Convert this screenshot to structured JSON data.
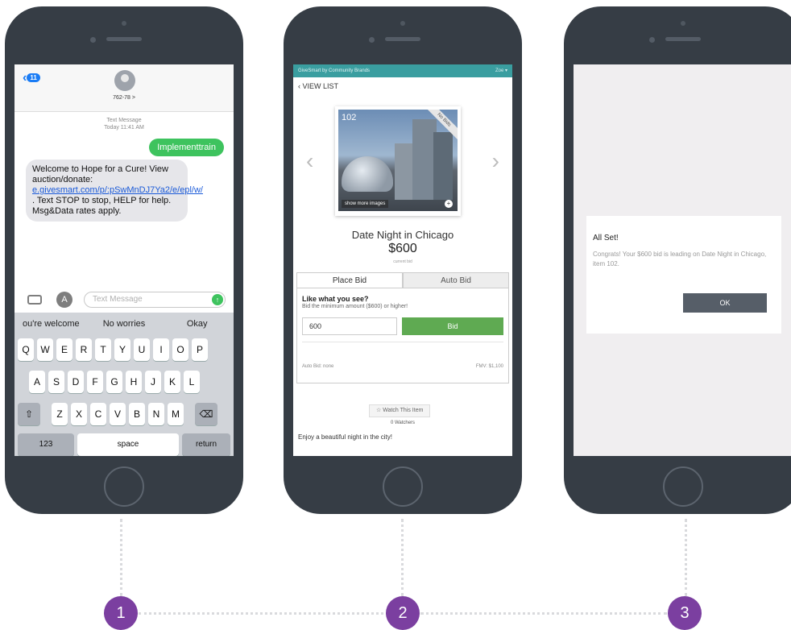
{
  "phone1": {
    "back_badge": "11",
    "contact": "762-78 >",
    "meta_type": "Text Message",
    "meta_time": "Today 11:41 AM",
    "outgoing": "Implementtrain",
    "incoming_pre": "Welcome to Hope for a Cure! View auction/donate: ",
    "incoming_link": "e.givesmart.com/p/:pSwMnDJ7Ya2/e/epl/w/",
    "incoming_post": " . Text STOP to stop, HELP for help. Msg&Data rates apply.",
    "input_placeholder": "Text Message",
    "suggestions": [
      "ou're welcome",
      "No worries",
      "Okay"
    ],
    "keys_row1": [
      "Q",
      "W",
      "E",
      "R",
      "T",
      "Y",
      "U",
      "I",
      "O",
      "P"
    ],
    "keys_row2": [
      "A",
      "S",
      "D",
      "F",
      "G",
      "H",
      "J",
      "K",
      "L"
    ],
    "keys_row3": [
      "Z",
      "X",
      "C",
      "V",
      "B",
      "N",
      "M"
    ],
    "key_123": "123",
    "key_space": "space",
    "key_return": "return"
  },
  "phone2": {
    "brand": "GiveSmart by Community Brands",
    "user": "Zoe ▾",
    "view_list": "VIEW LIST",
    "lot": "102",
    "no_bids": "No Bids",
    "show_more": "show more images",
    "title": "Date Night in Chicago",
    "price": "$600",
    "price_caption": "current bid",
    "tab_place": "Place Bid",
    "tab_auto": "Auto Bid",
    "like_title": "Like what you see?",
    "like_sub": "Bid the minimum amount ($600) or higher!",
    "bid_value": "600",
    "bid_button": "Bid",
    "auto_bid": "Auto Bid: none",
    "fmv": "FMV: $1,100",
    "watch": "Watch This Item",
    "watchers": "0 Watchers",
    "description": "Enjoy a beautiful night in the city!"
  },
  "phone3": {
    "dialog_title": "All Set!",
    "dialog_message": "Congrats! Your $600 bid is leading on Date Night in Chicago, item 102.",
    "ok": "OK"
  },
  "steps": [
    "1",
    "2",
    "3"
  ],
  "colors": {
    "accent_purple": "#7b3fa0",
    "ios_green": "#3ec35e",
    "ios_blue": "#1a7cf5",
    "teal": "#3a9ea0",
    "bid_green": "#5faa52",
    "phone_body": "#363d45"
  }
}
